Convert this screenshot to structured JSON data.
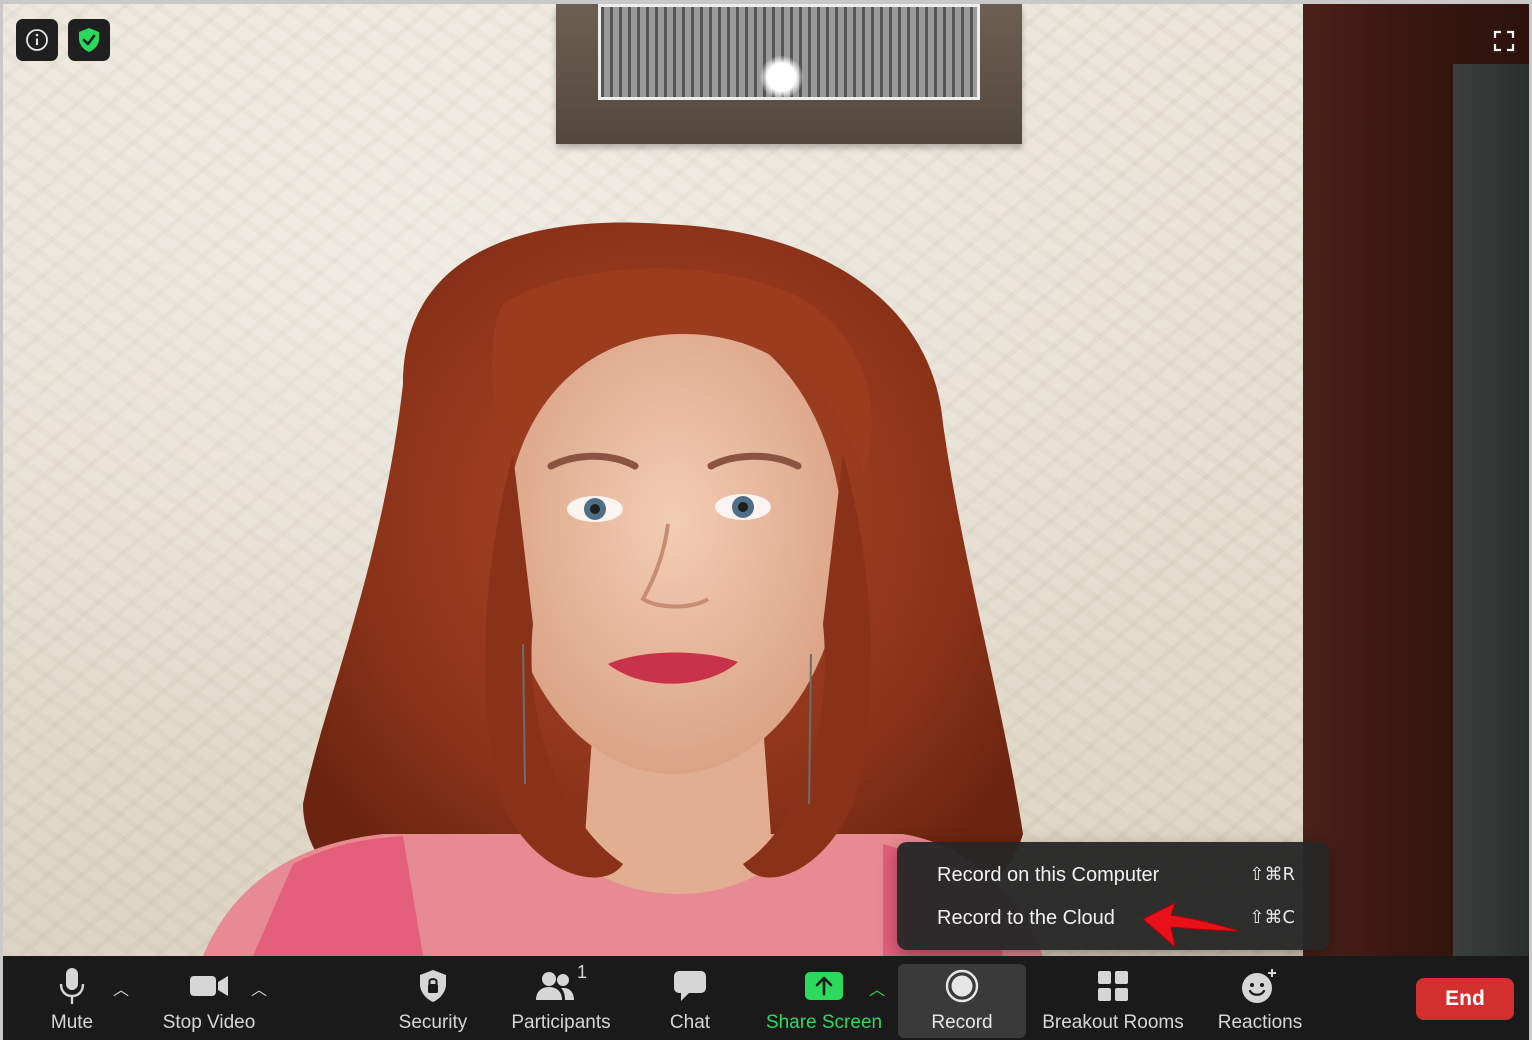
{
  "toolbar": {
    "mute_label": "Mute",
    "stop_video_label": "Stop Video",
    "security_label": "Security",
    "participants_label": "Participants",
    "participants_count": "1",
    "chat_label": "Chat",
    "share_screen_label": "Share Screen",
    "record_label": "Record",
    "breakout_rooms_label": "Breakout Rooms",
    "reactions_label": "Reactions",
    "end_label": "End"
  },
  "record_menu": {
    "items": [
      {
        "label": "Record on this Computer",
        "shortcut": "⇧⌘R"
      },
      {
        "label": "Record to the Cloud",
        "shortcut": "⇧⌘C"
      }
    ]
  },
  "colors": {
    "share_green": "#2bd95d",
    "end_red": "#d22f2f",
    "shield_green": "#2bd95d",
    "annotation_arrow": "#e8111a"
  },
  "icons": {
    "info": "info-icon",
    "shield": "encryption-shield-icon",
    "fullscreen": "fullscreen-icon"
  }
}
